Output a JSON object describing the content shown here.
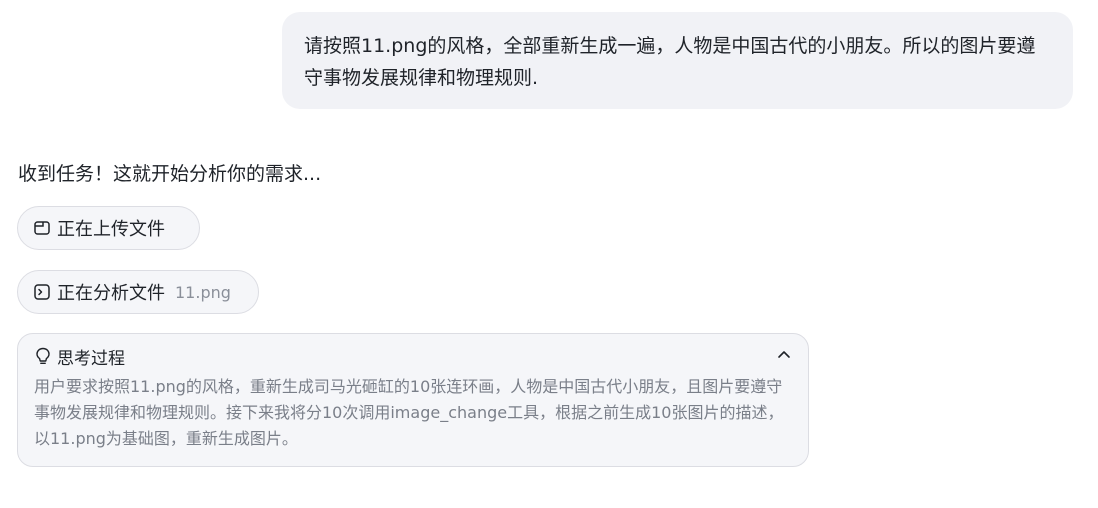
{
  "user_message": {
    "text": "请按照11.png的风格，全部重新生成一遍，人物是中国古代的小朋友。所以的图片要遵守事物发展规律和物理规则."
  },
  "assistant": {
    "reply": "收到任务！这就开始分析你的需求...",
    "steps": [
      {
        "icon": "file-icon",
        "label": "正在上传文件",
        "file": ""
      },
      {
        "icon": "terminal-icon",
        "label": "正在分析文件",
        "file": "11.png"
      }
    ],
    "thinking": {
      "icon": "lightbulb-icon",
      "title": "思考过程",
      "collapse_icon": "chevron-up-icon",
      "body": "用户要求按照11.png的风格，重新生成司马光砸缸的10张连环画，人物是中国古代小朋友，且图片要遵守事物发展规律和物理规则。接下来我将分10次调用image_change工具，根据之前生成10张图片的描述，以11.png为基础图，重新生成图片。"
    }
  },
  "colors": {
    "bubble_bg": "#f1f2f6",
    "pill_bg": "#f5f6f9",
    "border": "#dcdde3",
    "text": "#1f2329",
    "muted": "#7a7f89"
  }
}
